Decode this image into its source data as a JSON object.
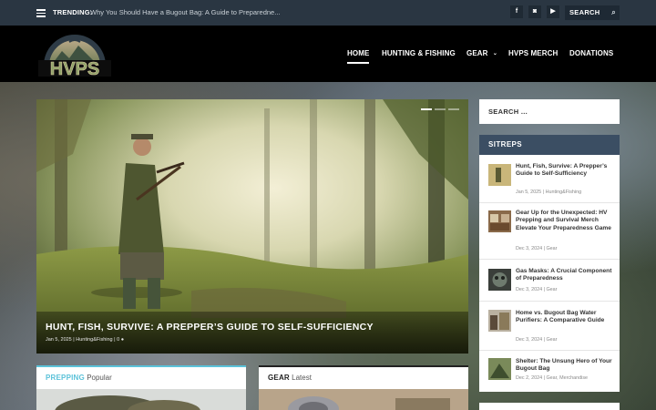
{
  "topbar": {
    "trending_label": "TRENDING:",
    "trending_text": "Why You Should Have a Bugout Bag: A Guide to Preparedne...",
    "social": [
      {
        "name": "facebook-icon",
        "glyph": "f"
      },
      {
        "name": "instagram-icon",
        "glyph": "◙"
      },
      {
        "name": "youtube-icon",
        "glyph": "▶"
      }
    ],
    "search_label": "SEARCH"
  },
  "header": {
    "logo_text": "HVPS",
    "nav": [
      {
        "label": "HOME",
        "active": true
      },
      {
        "label": "HUNTING & FISHING"
      },
      {
        "label": "GEAR",
        "dropdown": true
      },
      {
        "label": "HVPS MERCH"
      },
      {
        "label": "DONATIONS"
      }
    ]
  },
  "hero": {
    "title": "HUNT, FISH, SURVIVE: A PREPPER’S GUIDE TO SELF-SUFFICIENCY",
    "date": "Jan 5, 2025",
    "category": "Hunting&Fishing",
    "comments": "0"
  },
  "categories": [
    {
      "name": "PREPPING",
      "sub": "Popular",
      "accent": "#5bc2d9"
    },
    {
      "name": "GEAR",
      "sub": "Latest",
      "accent": "#222222"
    }
  ],
  "sidebar": {
    "search_placeholder": "SEARCH ...",
    "sitreps_title": "SITREPS",
    "posts": [
      {
        "title": "Hunt, Fish, Survive: A Prepper’s Guide to Self-Sufficiency",
        "meta": "Jan 5, 2025 | Hunting&Fishing"
      },
      {
        "title": "Gear Up for the Unexpected: HV Prepping and Survival Merch Elevate Your Preparedness Game",
        "meta": "Dec 3, 2024 | Gear"
      },
      {
        "title": "Gas Masks: A Crucial Component of Preparedness",
        "meta": "Dec 3, 2024 | Gear"
      },
      {
        "title": "Home vs. Bugout Bag Water Purifiers: A Comparative Guide",
        "meta": "Dec 3, 2024 | Gear"
      },
      {
        "title": "Shelter: The Unsung Hero of Your Bugout Bag",
        "meta": "Dec 2, 2024 | Gear, Merchandise"
      }
    ]
  }
}
